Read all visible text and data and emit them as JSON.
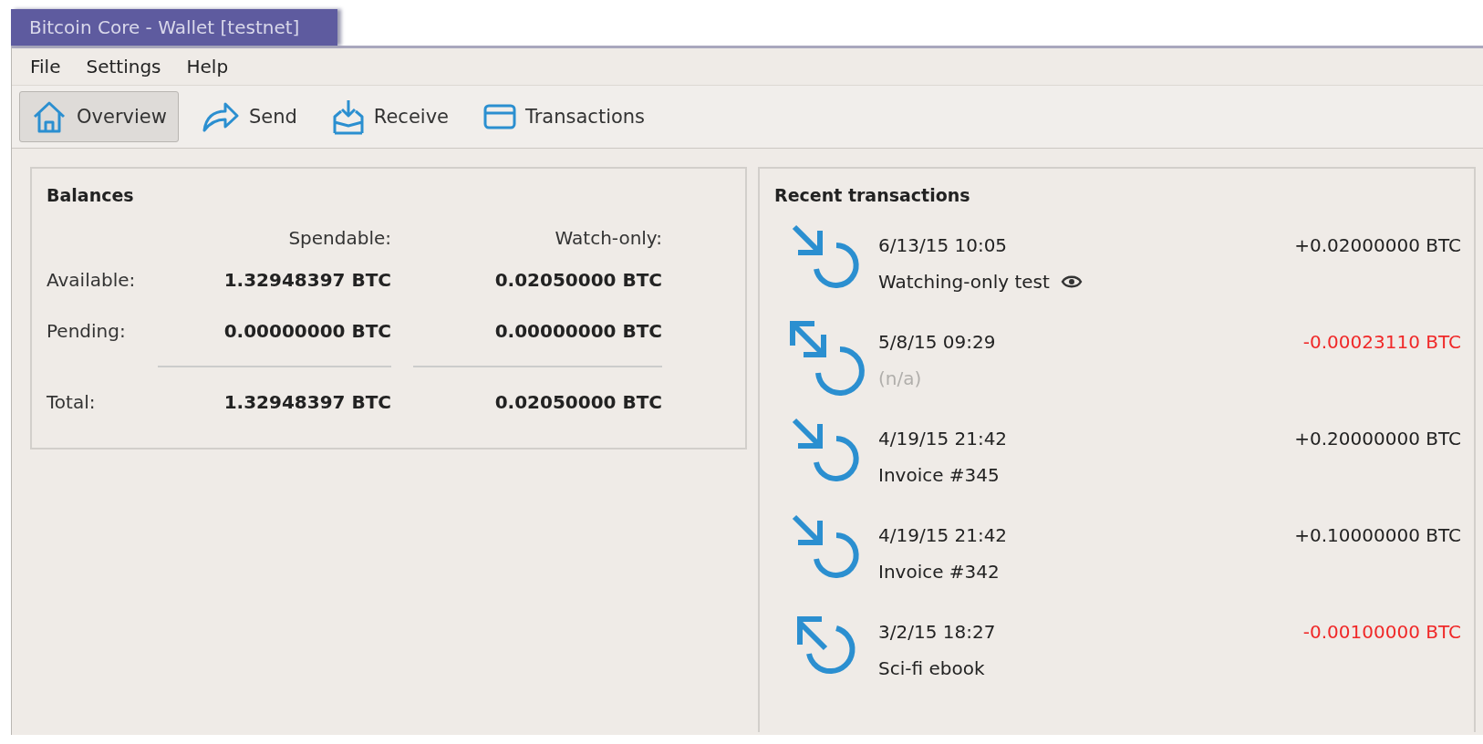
{
  "window": {
    "title": "Bitcoin Core - Wallet [testnet]"
  },
  "menu": [
    "File",
    "Settings",
    "Help"
  ],
  "toolbar": [
    {
      "kind": "overview",
      "label": "Overview",
      "selected": true
    },
    {
      "kind": "send",
      "label": "Send",
      "selected": false
    },
    {
      "kind": "receive",
      "label": "Receive",
      "selected": false
    },
    {
      "kind": "transactions",
      "label": "Transactions",
      "selected": false
    }
  ],
  "balances": {
    "title": "Balances",
    "columns": [
      "Spendable:",
      "Watch-only:"
    ],
    "rows": [
      {
        "label": "Available:",
        "values": [
          "1.32948397 BTC",
          "0.02050000 BTC"
        ]
      },
      {
        "label": "Pending:",
        "values": [
          "0.00000000 BTC",
          "0.00000000 BTC"
        ]
      },
      {
        "label": "Total:",
        "values": [
          "1.32948397 BTC",
          "0.02050000 BTC"
        ]
      }
    ]
  },
  "recent": {
    "title": "Recent transactions",
    "items": [
      {
        "kind": "incoming",
        "date": "6/13/15 10:05",
        "label": "Watching-only test",
        "label_disabled": false,
        "watch_only": true,
        "amount": "+0.02000000 BTC",
        "negative": false
      },
      {
        "kind": "self",
        "date": "5/8/15 09:29",
        "label": "(n/a)",
        "label_disabled": true,
        "watch_only": false,
        "amount": "-0.00023110 BTC",
        "negative": true
      },
      {
        "kind": "incoming",
        "date": "4/19/15 21:42",
        "label": "Invoice #345",
        "label_disabled": false,
        "watch_only": false,
        "amount": "+0.20000000 BTC",
        "negative": false
      },
      {
        "kind": "incoming",
        "date": "4/19/15 21:42",
        "label": "Invoice #342",
        "label_disabled": false,
        "watch_only": false,
        "amount": "+0.10000000 BTC",
        "negative": false
      },
      {
        "kind": "outgoing",
        "date": "3/2/15 18:27",
        "label": "Sci-fi ebook",
        "label_disabled": false,
        "watch_only": false,
        "amount": "-0.00100000 BTC",
        "negative": true
      }
    ]
  }
}
